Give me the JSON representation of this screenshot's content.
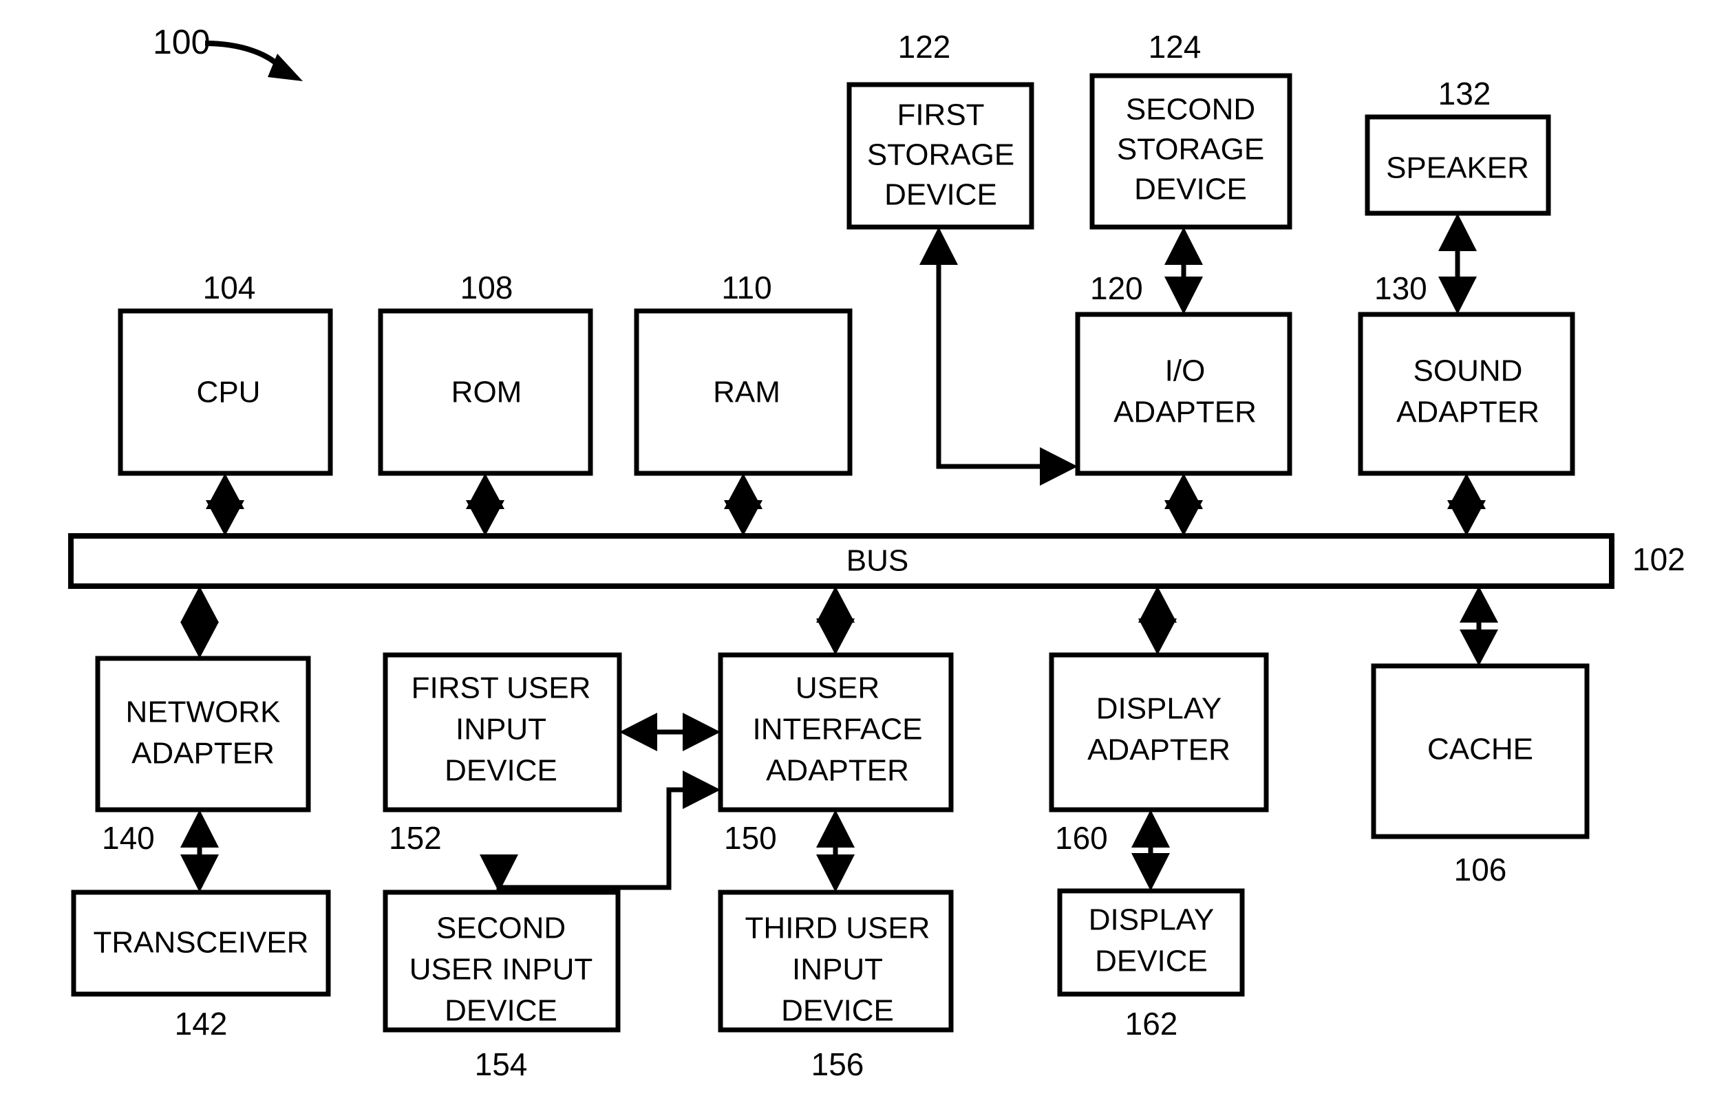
{
  "figure": {
    "reference_numeral": "100",
    "background_color": "#ffffff",
    "line_color": "#000000"
  },
  "blocks": [
    {
      "id": "first_storage_device",
      "ref": "122",
      "lines": [
        "FIRST",
        "STORAGE",
        "DEVICE"
      ]
    },
    {
      "id": "second_storage_device",
      "ref": "124",
      "lines": [
        "SECOND",
        "STORAGE",
        "DEVICE"
      ]
    },
    {
      "id": "speaker",
      "ref": "132",
      "lines": [
        "SPEAKER"
      ]
    },
    {
      "id": "cpu",
      "ref": "104",
      "lines": [
        "CPU"
      ]
    },
    {
      "id": "rom",
      "ref": "108",
      "lines": [
        "ROM"
      ]
    },
    {
      "id": "ram",
      "ref": "110",
      "lines": [
        "RAM"
      ]
    },
    {
      "id": "io_adapter",
      "ref": "120",
      "lines": [
        "I/O",
        "ADAPTER"
      ]
    },
    {
      "id": "sound_adapter",
      "ref": "130",
      "lines": [
        "SOUND",
        "ADAPTER"
      ]
    },
    {
      "id": "bus",
      "ref": "102",
      "lines": [
        "BUS"
      ]
    },
    {
      "id": "network_adapter",
      "ref": "140",
      "lines": [
        "NETWORK",
        "ADAPTER"
      ]
    },
    {
      "id": "first_user_input_device",
      "ref": "152",
      "lines": [
        "FIRST USER",
        "INPUT",
        "DEVICE"
      ]
    },
    {
      "id": "user_interface_adapter",
      "ref": "150",
      "lines": [
        "USER",
        "INTERFACE",
        "ADAPTER"
      ]
    },
    {
      "id": "display_adapter",
      "ref": "160",
      "lines": [
        "DISPLAY",
        "ADAPTER"
      ]
    },
    {
      "id": "cache",
      "ref": "106",
      "lines": [
        "CACHE"
      ]
    },
    {
      "id": "transceiver",
      "ref": "142",
      "lines": [
        "TRANSCEIVER"
      ]
    },
    {
      "id": "second_user_input_device",
      "ref": "154",
      "lines": [
        "SECOND",
        "USER INPUT",
        "DEVICE"
      ]
    },
    {
      "id": "third_user_input_device",
      "ref": "156",
      "lines": [
        "THIRD USER",
        "INPUT",
        "DEVICE"
      ]
    },
    {
      "id": "display_device",
      "ref": "162",
      "lines": [
        "DISPLAY",
        "DEVICE"
      ]
    }
  ],
  "labels": {
    "fig_100": "100",
    "ref_122": "122",
    "ref_124": "124",
    "ref_132": "132",
    "ref_104": "104",
    "ref_108": "108",
    "ref_110": "110",
    "ref_120": "120",
    "ref_130": "130",
    "ref_102": "102",
    "ref_140": "140",
    "ref_152": "152",
    "ref_150": "150",
    "ref_160": "160",
    "ref_106": "106",
    "ref_142": "142",
    "ref_154": "154",
    "ref_156": "156",
    "ref_162": "162"
  },
  "text": {
    "first_storage_l1": "FIRST",
    "first_storage_l2": "STORAGE",
    "first_storage_l3": "DEVICE",
    "second_storage_l1": "SECOND",
    "second_storage_l2": "STORAGE",
    "second_storage_l3": "DEVICE",
    "speaker_l1": "SPEAKER",
    "cpu_l1": "CPU",
    "rom_l1": "ROM",
    "ram_l1": "RAM",
    "io_adapter_l1": "I/O",
    "io_adapter_l2": "ADAPTER",
    "sound_adapter_l1": "SOUND",
    "sound_adapter_l2": "ADAPTER",
    "bus_l1": "BUS",
    "network_adapter_l1": "NETWORK",
    "network_adapter_l2": "ADAPTER",
    "first_uid_l1": "FIRST USER",
    "first_uid_l2": "INPUT",
    "first_uid_l3": "DEVICE",
    "uia_l1": "USER",
    "uia_l2": "INTERFACE",
    "uia_l3": "ADAPTER",
    "display_adapter_l1": "DISPLAY",
    "display_adapter_l2": "ADAPTER",
    "cache_l1": "CACHE",
    "transceiver_l1": "TRANSCEIVER",
    "second_uid_l1": "SECOND",
    "second_uid_l2": "USER INPUT",
    "second_uid_l3": "DEVICE",
    "third_uid_l1": "THIRD USER",
    "third_uid_l2": "INPUT",
    "third_uid_l3": "DEVICE",
    "display_device_l1": "DISPLAY",
    "display_device_l2": "DEVICE"
  },
  "connections": [
    {
      "from": "first_storage_device",
      "to": "io_adapter",
      "style": "elbow",
      "arrows": "both-ends"
    },
    {
      "from": "second_storage_device",
      "to": "io_adapter",
      "style": "vertical",
      "arrows": "double"
    },
    {
      "from": "speaker",
      "to": "sound_adapter",
      "style": "vertical",
      "arrows": "double"
    },
    {
      "from": "cpu",
      "to": "bus",
      "style": "vertical",
      "arrows": "double"
    },
    {
      "from": "rom",
      "to": "bus",
      "style": "vertical",
      "arrows": "double"
    },
    {
      "from": "ram",
      "to": "bus",
      "style": "vertical",
      "arrows": "double"
    },
    {
      "from": "io_adapter",
      "to": "bus",
      "style": "vertical",
      "arrows": "double"
    },
    {
      "from": "sound_adapter",
      "to": "bus",
      "style": "vertical",
      "arrows": "double"
    },
    {
      "from": "bus",
      "to": "network_adapter",
      "style": "vertical",
      "arrows": "double"
    },
    {
      "from": "bus",
      "to": "user_interface_adapter",
      "style": "vertical",
      "arrows": "double"
    },
    {
      "from": "bus",
      "to": "display_adapter",
      "style": "vertical",
      "arrows": "double"
    },
    {
      "from": "bus",
      "to": "cache",
      "style": "vertical",
      "arrows": "single-down"
    },
    {
      "from": "network_adapter",
      "to": "transceiver",
      "style": "vertical",
      "arrows": "double"
    },
    {
      "from": "first_user_input_device",
      "to": "user_interface_adapter",
      "style": "horizontal",
      "arrows": "double"
    },
    {
      "from": "user_interface_adapter",
      "to": "second_user_input_device",
      "style": "z-elbow",
      "arrows": "both-ends"
    },
    {
      "from": "user_interface_adapter",
      "to": "third_user_input_device",
      "style": "vertical",
      "arrows": "double"
    },
    {
      "from": "display_adapter",
      "to": "display_device",
      "style": "vertical",
      "arrows": "double"
    }
  ]
}
